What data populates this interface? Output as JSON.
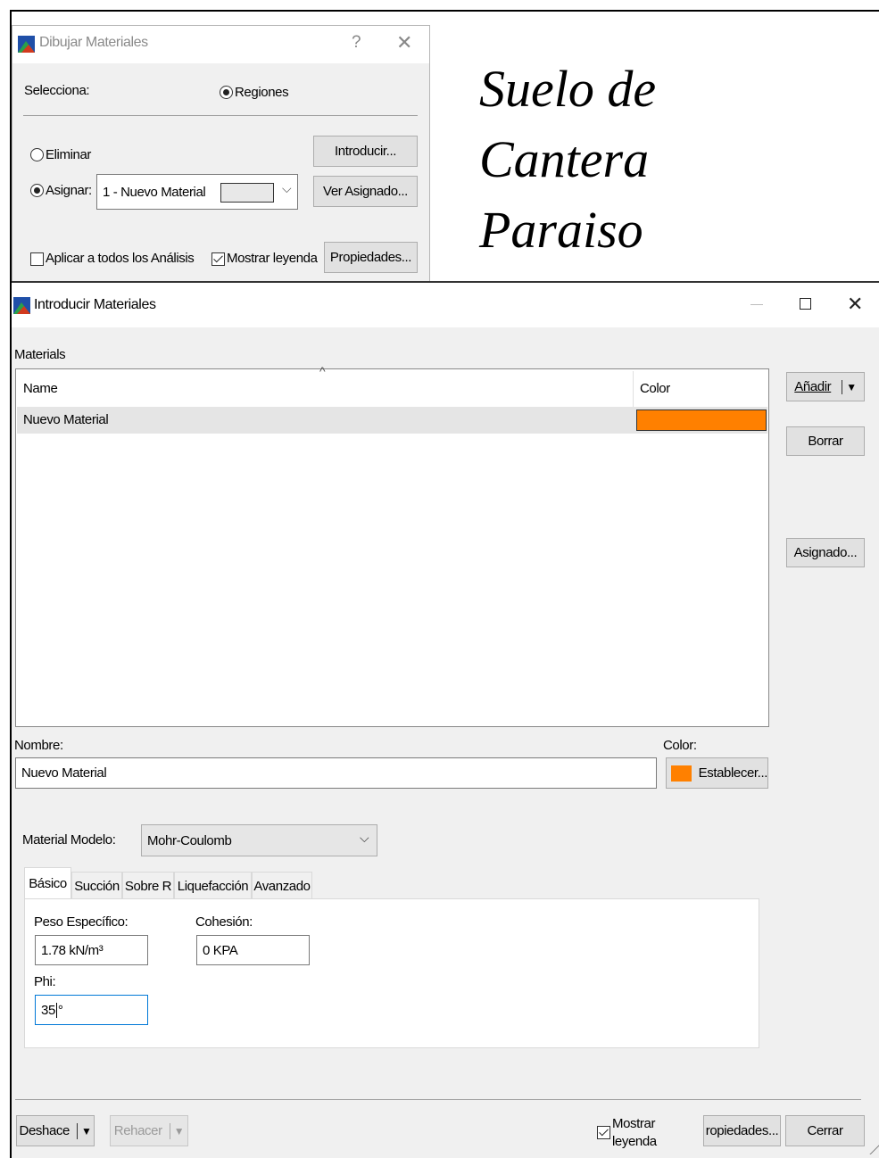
{
  "heading": {
    "line1": "Suelo de",
    "line2": "Cantera",
    "line3": "Paraiso"
  },
  "dialog_top": {
    "title": "Dibujar Materiales",
    "help_icon": "question-icon",
    "close_icon": "close-icon",
    "selecciona_label": "Selecciona:",
    "regiones_label": "Regiones",
    "eliminar_label": "Eliminar",
    "asignar_label": "Asignar:",
    "material_select_value": "1 - Nuevo Material",
    "introducir_button": "Introducir...",
    "ver_asignado_button": "Ver Asignado...",
    "aplicar_label": "Aplicar a todos los Análisis",
    "mostrar_leyenda_label": "Mostrar leyenda",
    "propiedades_button": "Propiedades..."
  },
  "dialog_main": {
    "title": "Introducir Materiales",
    "minimize_icon": "minimize-icon",
    "maximize_icon": "maximize-icon",
    "close_icon": "close-icon",
    "materials_label": "Materials",
    "table": {
      "columns": [
        "Name",
        "Color"
      ],
      "rows": [
        {
          "name": "Nuevo Material",
          "color": "#ff8000"
        }
      ]
    },
    "anadir_button": "Añadir",
    "borrar_button": "Borrar",
    "asignado_button": "Asignado...",
    "nombre_label": "Nombre:",
    "nombre_value": "Nuevo Material",
    "color_label": "Color:",
    "color_swatch": "#ff8000",
    "establecer_button": "Establecer...",
    "material_modelo_label": "Material Modelo:",
    "material_modelo_value": "Mohr-Coulomb",
    "tabs": [
      "Básico",
      "Succión",
      "Sobre R",
      "Liquefacción",
      "Avanzado"
    ],
    "active_tab": "Básico",
    "peso_label": "Peso Específico:",
    "peso_value": "1.78 kN/m³",
    "cohesion_label": "Cohesión:",
    "cohesion_value": "0 KPA",
    "phi_label": "Phi:",
    "phi_value": "35",
    "phi_unit": "°",
    "deshace_button": "Deshace",
    "rehacer_button": "Rehacer",
    "mostrar_label": "Mostrar",
    "leyenda_label": "leyenda",
    "propiedades_button": "ropiedades...",
    "cerrar_button": "Cerrar"
  }
}
